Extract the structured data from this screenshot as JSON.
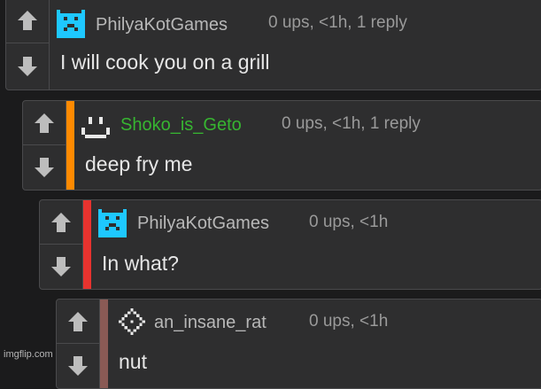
{
  "colors": {
    "page_bg": "#1b1b1c",
    "panel_bg": "#2e2e2f",
    "border": "#4a4a4c",
    "username_default": "#b8b8b8",
    "username_green": "#37b531",
    "meta": "#9a9a9a",
    "accent_orange": "#ff8a00",
    "accent_red": "#e8332f",
    "accent_brown": "#8a5a55",
    "avatar_cyan": "#1ec8ff"
  },
  "comments": [
    {
      "username": "PhilyaKotGames",
      "meta": "0 ups, <1h, 1 reply",
      "text": "I will cook you on a grill",
      "avatar_icon": "cat-pixel-icon"
    },
    {
      "username": "Shoko_is_Geto",
      "meta": "0 ups, <1h, 1 reply",
      "text": "deep fry me",
      "avatar_icon": "smile-pixel-icon"
    },
    {
      "username": "PhilyaKotGames",
      "meta": "0 ups, <1h",
      "text": "In what?",
      "avatar_icon": "cat-pixel-icon"
    },
    {
      "username": "an_insane_rat",
      "meta": "0 ups, <1h",
      "text": "nut",
      "avatar_icon": "diamond-pixel-icon"
    }
  ],
  "watermark": "imgflip.com"
}
